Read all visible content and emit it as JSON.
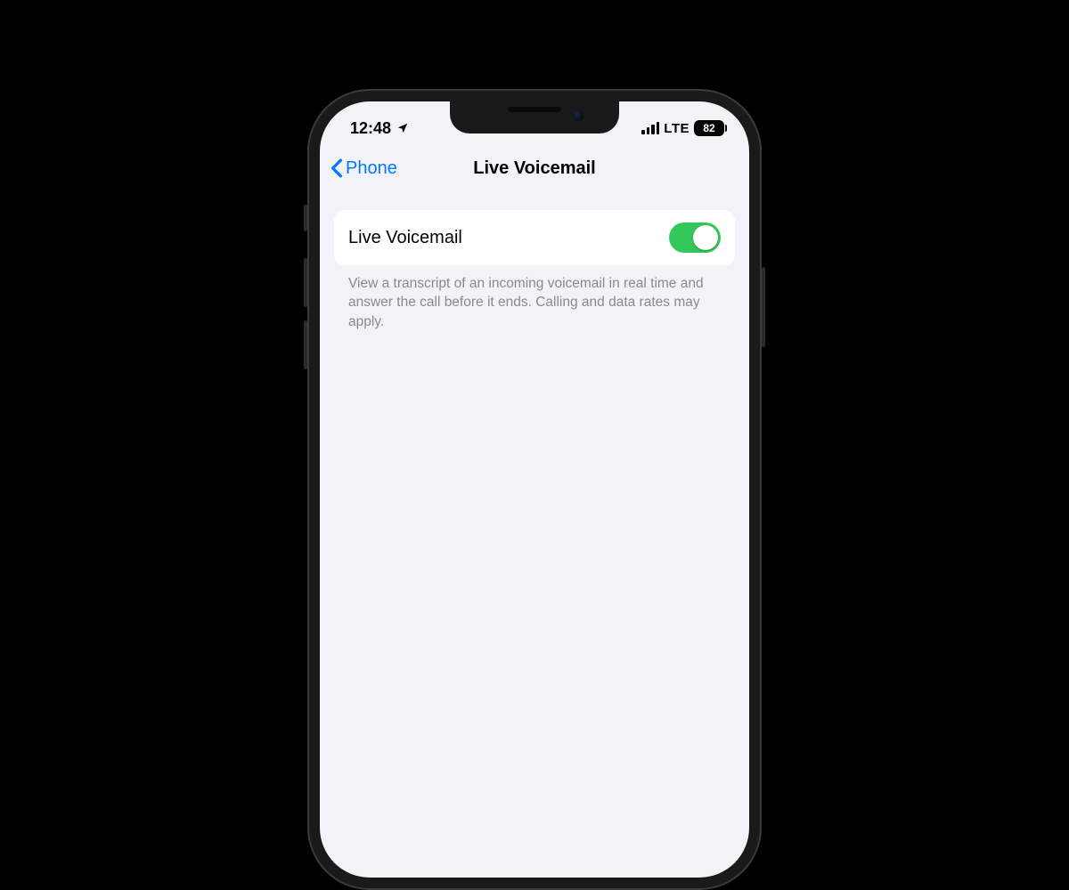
{
  "status": {
    "time": "12:48",
    "network_type": "LTE",
    "battery_percent": "82"
  },
  "nav": {
    "back_label": "Phone",
    "title": "Live Voicemail"
  },
  "setting": {
    "label": "Live Voicemail",
    "enabled": true,
    "description": "View a transcript of an incoming voicemail in real time and answer the call before it ends. Calling and data rates may apply."
  },
  "colors": {
    "accent_blue": "#007aff",
    "toggle_green": "#34c759"
  }
}
